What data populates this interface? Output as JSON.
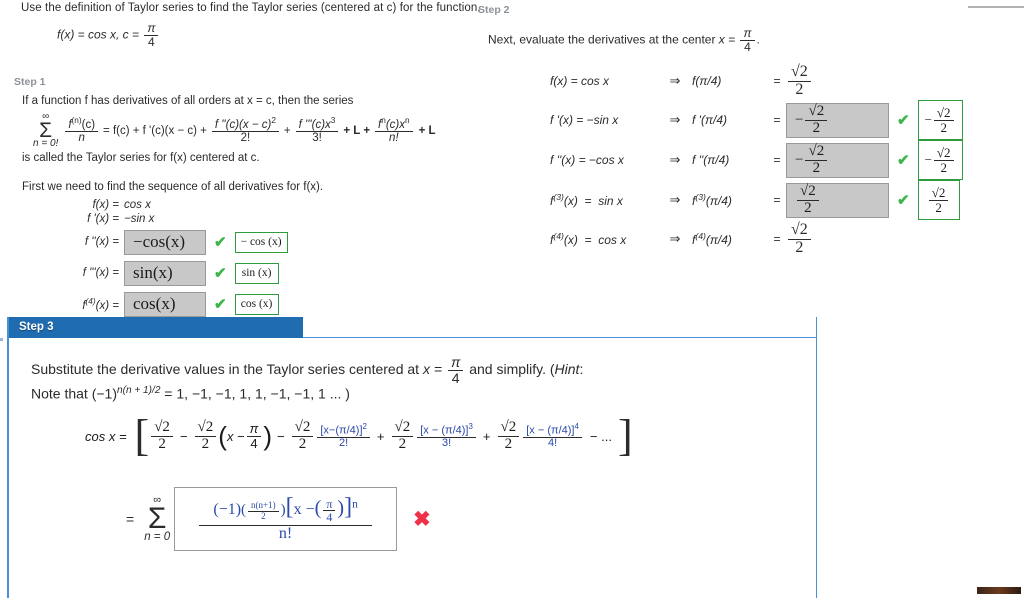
{
  "prompt": {
    "text": "Use the definition of Taylor series to find the Taylor series (centered at c) for the function.",
    "function_label": "f(x)  =  cos x,   c =",
    "center_num": "π",
    "center_den": "4"
  },
  "step1": {
    "label": "Step 1",
    "intro": "If a function f has derivatives of all orders at  x = c,  then the series",
    "series": {
      "sum_top": "∞",
      "sum_bottom": "n = 0!",
      "lead_num": "f",
      "lead_sup": "(n)",
      "lead_rest": "(c)",
      "lead_den": "n",
      "expansion": "= f(c) + f '(c)(x − c) +",
      "t2_num": "f ''(c)(x − c)",
      "t2_sup": "2",
      "t2_den": "2!",
      "t3_num": "f '''(c)x",
      "t3_sup": "3",
      "t3_den": "3!",
      "plus_L1": "+ L +",
      "tn_num": "f",
      "tn_sup1": "n",
      "tn_mid": "(c)x",
      "tn_sup2": "n",
      "tn_den": "n!",
      "plus_L2": "+ L"
    },
    "called": "is called the Taylor series for  f(x)  centered at c.",
    "first": "First we need to find the sequence of all derivatives for  f(x).",
    "derivatives": [
      {
        "label": "f(x)  =",
        "value": "cos x",
        "type": "static"
      },
      {
        "label": "f '(x)  =",
        "value": "−sin x",
        "type": "static"
      },
      {
        "label": "f ''(x)  =",
        "value": "−cos(x)",
        "type": "input",
        "correct": true,
        "key": "− cos (x)"
      },
      {
        "label": "f '''(x)  =",
        "value": "sin(x)",
        "type": "input",
        "correct": true,
        "key": "sin (x)"
      },
      {
        "label": "f(4)(x)  =",
        "value": "cos(x)",
        "type": "input",
        "correct": true,
        "key": "cos (x)"
      }
    ]
  },
  "step2": {
    "label": "Step 2",
    "intro_a": "Next, evaluate the derivatives at the center ",
    "intro_x": "x =",
    "intro_num": "π",
    "intro_den": "4",
    "intro_dot": ".",
    "rows": [
      {
        "lhs": "f(x)  =  cos x",
        "arrow": "⇒",
        "mid": "f(π/4)",
        "eq": "=",
        "value_sign": "",
        "value_num": "√2",
        "value_den": "2",
        "input": false,
        "correct": false,
        "key_sign": "",
        "key_num": "√2",
        "key_den": "2"
      },
      {
        "lhs": "f '(x)  =  −sin x",
        "arrow": "⇒",
        "mid": "f '(π/4)",
        "eq": "=",
        "value_sign": "−",
        "value_num": "√2",
        "value_den": "2",
        "input": true,
        "correct": true,
        "key_sign": "−",
        "key_num": "√2",
        "key_den": "2"
      },
      {
        "lhs": "f ''(x)  =  −cos x",
        "arrow": "⇒",
        "mid": "f ''(π/4)",
        "eq": "=",
        "value_sign": "−",
        "value_num": "√2",
        "value_den": "2",
        "input": true,
        "correct": true,
        "key_sign": "−",
        "key_num": "√2",
        "key_den": "2"
      },
      {
        "lhs": "f(3)(x)  =  sin x",
        "arrow": "⇒",
        "mid": "f(3)(π/4)",
        "eq": "=",
        "value_sign": "",
        "value_num": "√2",
        "value_den": "2",
        "input": true,
        "correct": true,
        "key_sign": "",
        "key_num": "√2",
        "key_den": "2"
      },
      {
        "lhs": "f(4)(x)  =  cos x",
        "arrow": "⇒",
        "mid": "f(4)(π/4)",
        "eq": "=",
        "value_sign": "",
        "value_num": "√2",
        "value_den": "2",
        "input": false,
        "correct": false,
        "key_sign": "",
        "key_num": "√2",
        "key_den": "2"
      }
    ]
  },
  "step3": {
    "label": "Step 3",
    "line1_a": "Substitute the derivative values in the Taylor series centered at ",
    "line1_x": "x =",
    "line1_num": "π",
    "line1_den": "4",
    "line1_b": " and simplify. (",
    "line1_hint": "Hint",
    "line1_c": ":",
    "line2_a": "Note that (−1)",
    "line2_sup": "n(n + 1)/2",
    "line2_b": " = 1, −1, −1, 1, 1, −1, −1, 1 ... )",
    "expansion": {
      "lead": "cos x  =",
      "t0_num": "√2",
      "t0_den": "2",
      "minus1": "−",
      "t1_num": "√2",
      "t1_den": "2",
      "t1_paren_a": "(",
      "t1_x": "x  − ",
      "t1_pnum": "π",
      "t1_pden": "4",
      "t1_paren_b": ")",
      "minus2": "−",
      "t2_cnum": "√2",
      "t2_cden": "2",
      "t2_num": "[x−(π/4)]",
      "t2_sup": "2",
      "t2_den": "2!",
      "plus3": "+",
      "t3_cnum": "√2",
      "t3_cden": "2",
      "t3_num": "[x − (π/4)]",
      "t3_sup": "3",
      "t3_den": "3!",
      "plus4": "+",
      "t4_cnum": "√2",
      "t4_cden": "2",
      "t4_num": "[x − (π/4)]",
      "t4_sup": "4",
      "t4_den": "4!",
      "tail": "−  ..."
    },
    "final": {
      "eq": "=",
      "sum_top": "∞",
      "sum_sigma": "Σ",
      "sum_bottom": "n = 0",
      "answer_base": "(−1)",
      "answer_exp_num": "n(n+1)",
      "answer_exp_den": "2",
      "answer_bracket_open": "[",
      "answer_x": "x −",
      "answer_pnum": "π",
      "answer_pden": "4",
      "answer_bracket_close": "]",
      "answer_power": "n",
      "answer_den": "n!",
      "correct": false,
      "mark": "✖"
    }
  },
  "colors": {
    "step_header_blue": "#1f6cb0",
    "panel_border_blue": "#4a90d9",
    "check_green": "#3cb54a",
    "key_border_green": "#2e9b3f",
    "cross_red": "#ee3048",
    "input_gray": "#c8c8c8",
    "math_blue": "#2a49a8",
    "step_label_gray": "#8c9199"
  }
}
